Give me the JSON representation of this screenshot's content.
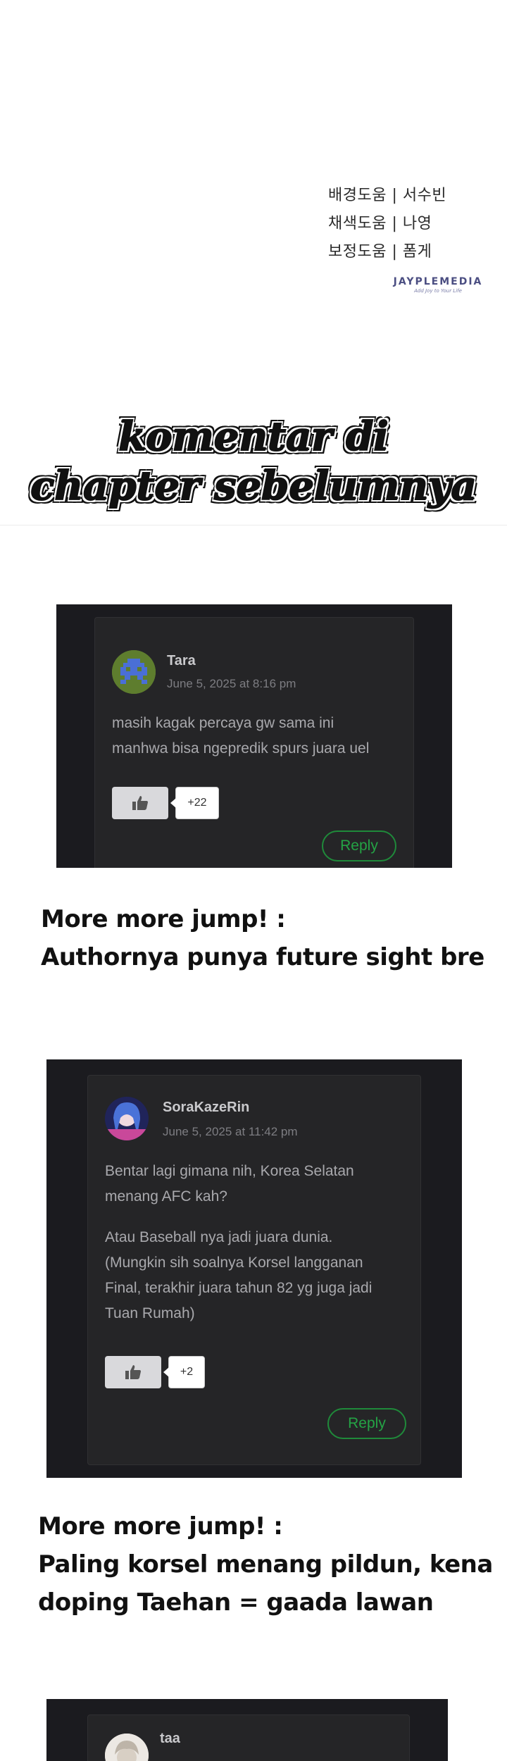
{
  "credits": {
    "lines": [
      "배경도움 | 서수빈",
      "채색도움 | 나영",
      "보정도움 | 폼게"
    ],
    "brand": "JAYPLEMEDIA",
    "brand_tagline": "Add Joy to Your Life"
  },
  "section_title": {
    "line1": "komentar di",
    "line2": "chapter sebelumnya"
  },
  "comments": [
    {
      "author": "Tara",
      "date": "June 5, 2025 at 8:16 pm",
      "paragraphs": [
        "masih kagak percaya gw sama ini",
        "manhwa bisa ngepredik spurs juara uel"
      ],
      "likes": "+22",
      "reply_label": "Reply"
    },
    {
      "author": "SoraKazeRin",
      "date": "June 5, 2025 at 11:42 pm",
      "paragraphs": [
        "Bentar lagi gimana nih, Korea Selatan",
        "menang AFC kah?",
        "Atau Baseball nya jadi juara dunia.",
        "(Mungkin sih soalnya Korsel langganan",
        "Final, terakhir juara tahun 82 yg juga jadi",
        "Tuan Rumah)"
      ],
      "likes": "+2",
      "reply_label": "Reply"
    },
    {
      "author": "taa"
    }
  ],
  "captions": [
    {
      "line1": "More more jump! :",
      "line2": "Authornya punya future sight bre"
    },
    {
      "line1": "More more jump! :",
      "line2": "Paling korsel menang pildun, kena",
      "line3": "doping Taehan = gaada lawan"
    }
  ],
  "colors": {
    "panel_bg": "#1b1b1f",
    "card_bg": "#252527",
    "reply_green": "#24a345",
    "brand": "#4b4e82"
  },
  "icons": [
    "thumbs-up-icon"
  ]
}
